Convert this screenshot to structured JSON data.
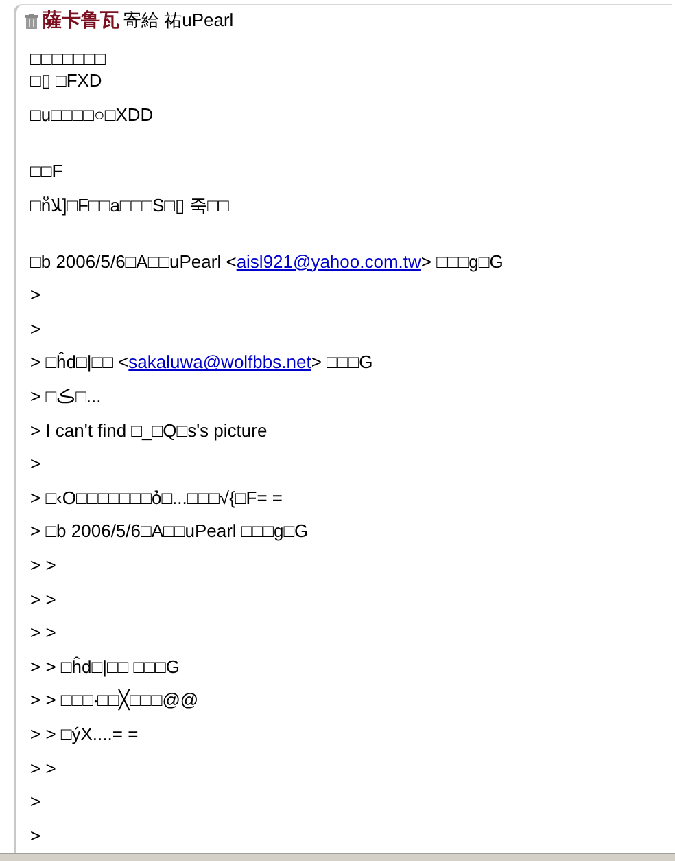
{
  "header": {
    "sender": "薩卡鲁瓦",
    "recipient": "寄給 祐uPearl"
  },
  "paragraphs": [
    {
      "lines": [
        "□□□□□□□",
        "□▯ □FXD"
      ],
      "trailing_break": false
    },
    {
      "lines": [
        "□u□□□□○□XDD"
      ],
      "trailing_break": true
    },
    {
      "lines": [
        "□□F"
      ],
      "trailing_break": false
    },
    {
      "lines": [
        "□ň̈ﻼ]□F□□a□□□S□▯ 죽□□"
      ],
      "trailing_break": true
    }
  ],
  "quoted_lines": [
    [
      {
        "text": "□b 2006/5/6□A□□uPearl <"
      },
      {
        "link": "aisl921@yahoo.com.tw"
      },
      {
        "text": "> □□□g□G"
      }
    ],
    [
      {
        "text": ">"
      }
    ],
    [
      {
        "text": ">"
      }
    ],
    [
      {
        "text": "> □ĥd□|□□ <"
      },
      {
        "link": "sakaluwa@wolfbbs.net"
      },
      {
        "text": "> □□□G"
      }
    ],
    [
      {
        "text": "> □ڪ□..."
      }
    ],
    [
      {
        "text": "> I can't find □_□Q□s's picture"
      }
    ],
    [
      {
        "text": ">"
      }
    ],
    [
      {
        "text": "> □‹O□□□□□□□ỏ□...□□□√{□F= ="
      }
    ],
    [
      {
        "text": "> □b 2006/5/6□A□□uPearl □□□g□G"
      }
    ],
    [
      {
        "text": "> >"
      }
    ],
    [
      {
        "text": "> >"
      }
    ],
    [
      {
        "text": "> >"
      }
    ],
    [
      {
        "text": "> > □ĥd□|□□ □□□G"
      }
    ],
    [
      {
        "text": "> > □□□‧□□╳□□□@@"
      }
    ],
    [
      {
        "text": "> > □ýX....= ="
      }
    ],
    [
      {
        "text": "> >"
      }
    ],
    [
      {
        "text": ">"
      }
    ],
    [
      {
        "text": ">"
      }
    ]
  ]
}
